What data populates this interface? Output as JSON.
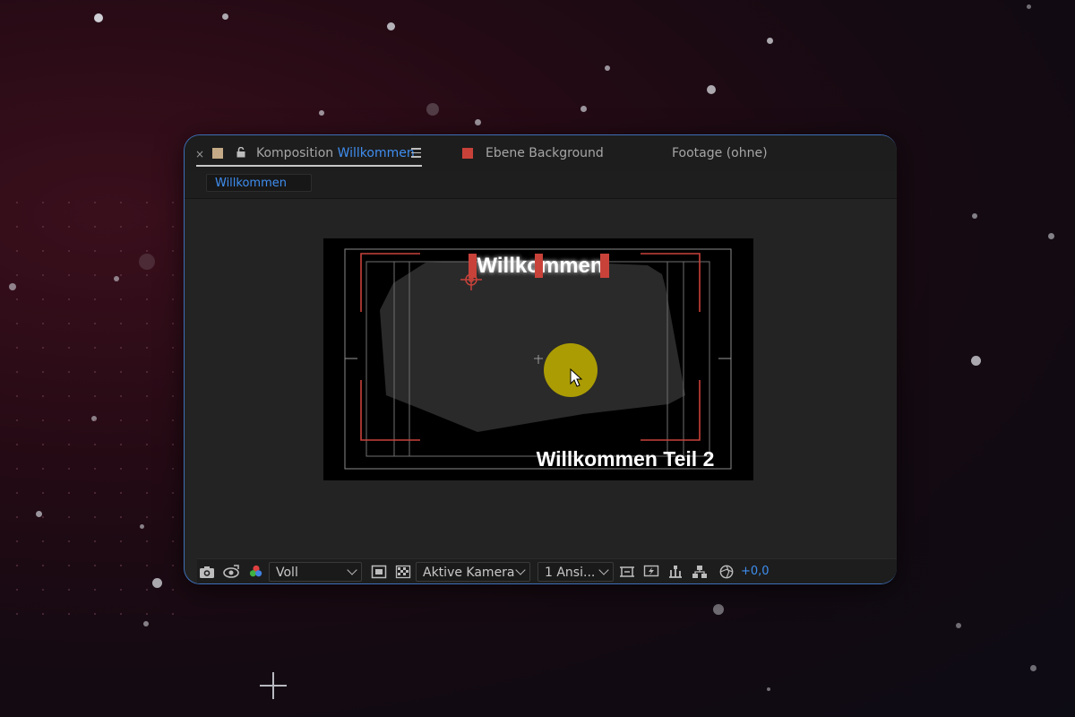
{
  "tabs": {
    "close_glyph": "×",
    "composition_prefix": "Komposition",
    "composition_name": "Willkommen",
    "layer_tab": "Ebene Background",
    "footage_tab": "Footage (ohne)"
  },
  "breadcrumb": "Willkommen",
  "viewer": {
    "title_text": "Willkommen",
    "subtitle_text": "Willkommen Teil 2"
  },
  "toolbar": {
    "resolution": "Voll",
    "camera": "Aktive Kamera",
    "views": "1 Ansi...",
    "exposure": "+0,0"
  },
  "colors": {
    "accent_blue": "#3f8ef0",
    "layer_red": "#c8423a",
    "comp_swatch": "#c4aa86",
    "cursor_highlight": "#b9a800"
  }
}
